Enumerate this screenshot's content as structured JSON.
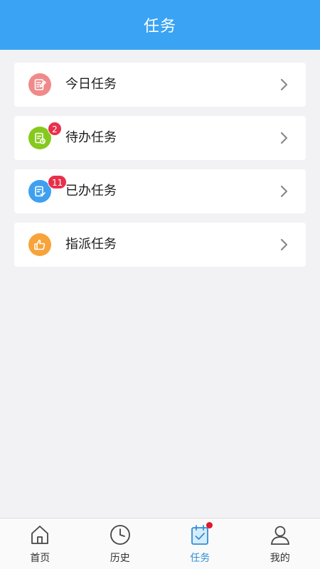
{
  "header": {
    "title": "任务"
  },
  "tasks": [
    {
      "label": "今日任务",
      "icon": "edit-note-icon",
      "color": "#f08a8a",
      "badge": null
    },
    {
      "label": "待办任务",
      "icon": "clipboard-clock-icon",
      "color": "#86c91d",
      "badge": "2"
    },
    {
      "label": "已办任务",
      "icon": "clipboard-check-icon",
      "color": "#3ea0ef",
      "badge": "11"
    },
    {
      "label": "指派任务",
      "icon": "thumbs-up-icon",
      "color": "#f7a33a",
      "badge": null
    }
  ],
  "tabbar": {
    "items": [
      {
        "label": "首页",
        "icon": "home-icon",
        "active": false
      },
      {
        "label": "历史",
        "icon": "clock-icon",
        "active": false
      },
      {
        "label": "任务",
        "icon": "task-calendar-icon",
        "active": true,
        "dot": true
      },
      {
        "label": "我的",
        "icon": "user-icon",
        "active": false
      }
    ],
    "active_color": "#2f8fd8"
  },
  "colors": {
    "header_bg": "#3aa3f3",
    "badge_bg": "#e8304a",
    "page_bg": "#f2f1f4"
  }
}
